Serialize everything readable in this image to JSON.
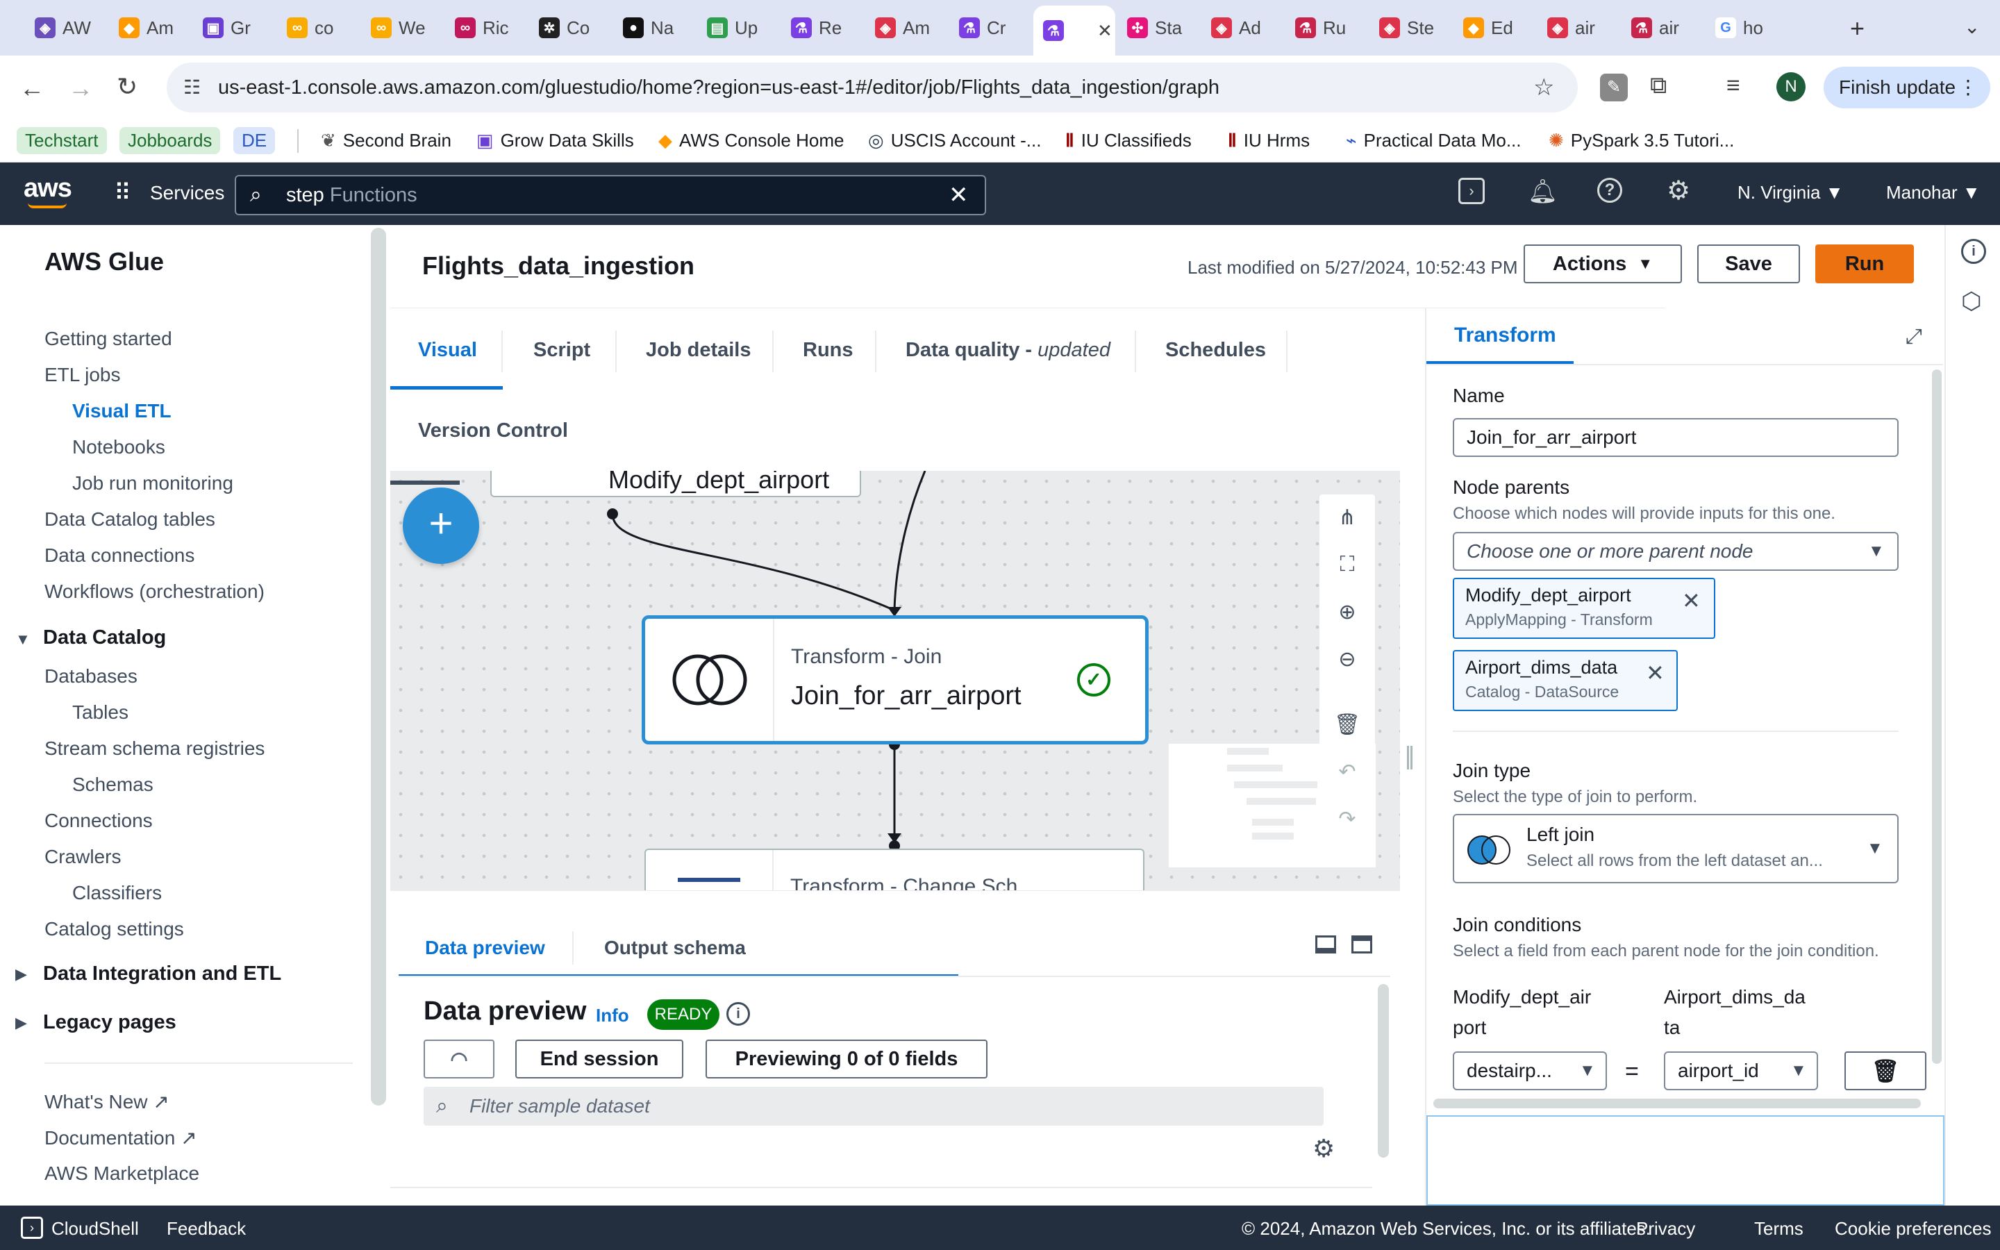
{
  "browser": {
    "tabs": [
      {
        "label": "AW",
        "icon": "aws-icon",
        "color": "#6b4fbb"
      },
      {
        "label": "Am",
        "icon": "amazon-icon",
        "color": "#ff9900"
      },
      {
        "label": "Gr",
        "icon": "grow-icon",
        "color": "#6a3fd3"
      },
      {
        "label": "co",
        "icon": "colab-icon",
        "color": "#f9ab00"
      },
      {
        "label": "We",
        "icon": "colab-icon",
        "color": "#f9ab00"
      },
      {
        "label": "Ric",
        "icon": "link-icon",
        "color": "#c2185b"
      },
      {
        "label": "Co",
        "icon": "chatgpt-icon",
        "color": "#222222"
      },
      {
        "label": "Na",
        "icon": "github-icon",
        "color": "#111111"
      },
      {
        "label": "Up",
        "icon": "upload-icon",
        "color": "#2e9e4f"
      },
      {
        "label": "Re",
        "icon": "glue-icon",
        "color": "#7b3fe4"
      },
      {
        "label": "Am",
        "icon": "aws-icon",
        "color": "#dd344c"
      },
      {
        "label": "Cr",
        "icon": "glue-icon",
        "color": "#7b3fe4"
      },
      {
        "label": "",
        "icon": "glue-icon",
        "color": "#7b3fe4"
      },
      {
        "label": "Sta",
        "icon": "stepfn-icon",
        "color": "#e7157b"
      },
      {
        "label": "Ad",
        "icon": "aws-icon",
        "color": "#dd344c"
      },
      {
        "label": "Ru",
        "icon": "glue-icon",
        "color": "#c7254e"
      },
      {
        "label": "Ste",
        "icon": "aws-icon",
        "color": "#dd344c"
      },
      {
        "label": "Ed",
        "icon": "amazon-icon",
        "color": "#ff9900"
      },
      {
        "label": "air",
        "icon": "aws-icon",
        "color": "#dd344c"
      },
      {
        "label": "air",
        "icon": "glue-icon",
        "color": "#c7254e"
      },
      {
        "label": "ho",
        "icon": "google-icon",
        "color": "#4285f4"
      }
    ],
    "url": "us-east-1.console.aws.amazon.com/gluestudio/home?region=us-east-1#/editor/job/Flights_data_ingestion/graph",
    "profile_initial": "N",
    "finish_update": "Finish update",
    "bookmarks": {
      "techstart": "Techstart",
      "jobboards": "Jobboards",
      "de": "DE",
      "second_brain": "Second Brain",
      "grow_data_skills": "Grow Data Skills",
      "aws_console_home": "AWS Console Home",
      "uscis": "USCIS Account -...",
      "iu_classifieds": "IU Classifieds",
      "iu_hrms": "IU Hrms",
      "practical_data": "Practical Data Mo...",
      "pyspark": "PySpark 3.5 Tutori..."
    }
  },
  "aws_nav": {
    "logo": "aws",
    "services": "Services",
    "search_value": "step",
    "search_hint": "Functions",
    "region": "N. Virginia",
    "user": "Manohar"
  },
  "sidebar": {
    "title": "AWS Glue",
    "items": {
      "getting_started": "Getting started",
      "etl_jobs": "ETL jobs",
      "visual_etl": "Visual ETL",
      "notebooks": "Notebooks",
      "job_run_monitoring": "Job run monitoring",
      "data_catalog_tables": "Data Catalog tables",
      "data_connections": "Data connections",
      "workflows": "Workflows (orchestration)",
      "data_catalog": "Data Catalog",
      "databases": "Databases",
      "tables": "Tables",
      "stream_schema": "Stream schema registries",
      "schemas": "Schemas",
      "connections": "Connections",
      "crawlers": "Crawlers",
      "classifiers": "Classifiers",
      "catalog_settings": "Catalog settings",
      "data_integration": "Data Integration and ETL",
      "legacy_pages": "Legacy pages",
      "whats_new": "What's New",
      "documentation": "Documentation",
      "marketplace": "AWS Marketplace"
    }
  },
  "job": {
    "title": "Flights_data_ingestion",
    "last_modified": "Last modified on 5/27/2024, 10:52:43 PM",
    "actions": "Actions",
    "save": "Save",
    "run": "Run"
  },
  "tabs": {
    "visual": "Visual",
    "script": "Script",
    "job_details": "Job details",
    "runs": "Runs",
    "data_quality": "Data quality - ",
    "data_quality_suffix": "updated",
    "schedules": "Schedules",
    "version_control": "Version Control"
  },
  "canvas": {
    "top_node_label": "Modify_dept_airport",
    "join_node_type": "Transform - Join",
    "join_node_name": "Join_for_arr_airport",
    "bottom_node_type": "Transform - Change Sch"
  },
  "bottom": {
    "tab_preview": "Data preview",
    "tab_schema": "Output schema",
    "heading": "Data preview",
    "info": "Info",
    "status": "READY",
    "end_session": "End session",
    "previewing": "Previewing 0 of 0 fields",
    "filter_placeholder": "Filter sample dataset"
  },
  "panel": {
    "tab": "Transform",
    "name_label": "Name",
    "name_value": "Join_for_arr_airport",
    "parents_label": "Node parents",
    "parents_desc": "Choose which nodes will provide inputs for this one.",
    "parents_placeholder": "Choose one or more parent node",
    "parents": [
      {
        "name": "Modify_dept_airport",
        "sub": "ApplyMapping - Transform"
      },
      {
        "name": "Airport_dims_data",
        "sub": "Catalog - DataSource"
      }
    ],
    "join_type_label": "Join type",
    "join_type_desc": "Select the type of join to perform.",
    "join_type_value": "Left join",
    "join_type_sub": "Select all rows from the left dataset an...",
    "conditions_label": "Join conditions",
    "conditions_desc": "Select a field from each parent node for the join condition.",
    "left_header_1": "Modify_dept_air",
    "left_header_2": "port",
    "right_header_1": "Airport_dims_da",
    "right_header_2": "ta",
    "left_value": "destairp...",
    "equals": "=",
    "right_value": "airport_id"
  },
  "footer": {
    "cloudshell": "CloudShell",
    "feedback": "Feedback",
    "copyright": "© 2024, Amazon Web Services, Inc. or its affiliates.",
    "privacy": "Privacy",
    "terms": "Terms",
    "cookies": "Cookie preferences"
  },
  "colors": {
    "aws_nav": "#232f3e",
    "accent_blue": "#0972d3",
    "run_orange": "#ec7211",
    "ready_green": "#037f0c"
  }
}
